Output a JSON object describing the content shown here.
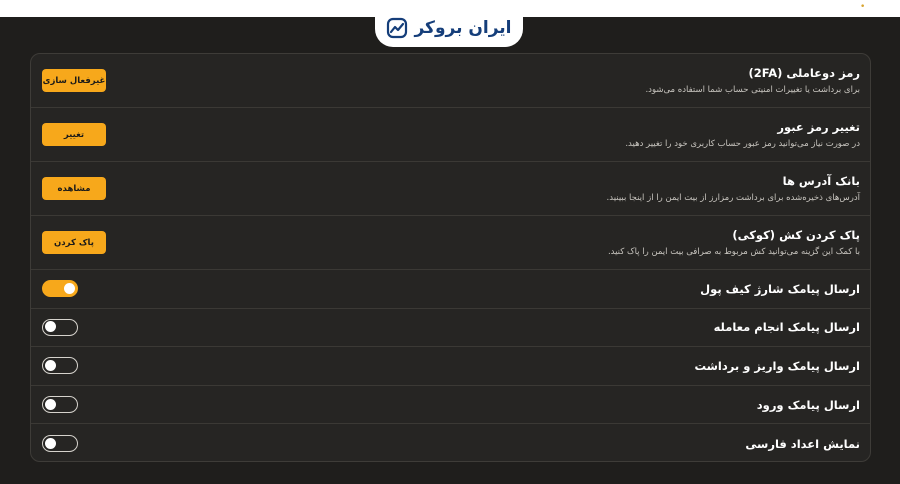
{
  "brand": {
    "name": "ایران بروکر",
    "color": "#153e7a"
  },
  "theme": {
    "accent": "#f7a81b",
    "background": "#1f1e1c",
    "card": "#262523"
  },
  "settings": [
    {
      "title": "رمز دوعاملی (2FA)",
      "description": "برای برداشت یا تغییرات امنیتی حساب شما استفاده می‌شود.",
      "button": "غیرفعال سازی"
    },
    {
      "title": "تغییر رمز عبور",
      "description": "در صورت نیاز می‌توانید رمز عبور حساب کاربری خود را تغییر دهید.",
      "button": "تغییر"
    },
    {
      "title": "بانک آدرس ها",
      "description": "آدرس‌های ذخیره‌شده برای برداشت رمزارز از بیت ایمن را از اینجا ببینید.",
      "button": "مشاهده"
    },
    {
      "title": "پاک کردن کش (کوکی)",
      "description": "با کمک این گزینه می‌توانید کش مربوط به صرافی بیت ایمن را پاک کنید.",
      "button": "پاک کردن"
    }
  ],
  "toggles": [
    {
      "label": "ارسال پیامک شارژ کیف پول",
      "on": true
    },
    {
      "label": "ارسال پیامک انجام معامله",
      "on": false
    },
    {
      "label": "ارسال پیامک واریز و برداشت",
      "on": false
    },
    {
      "label": "ارسال پیامک ورود",
      "on": false
    },
    {
      "label": "نمایش اعداد فارسی",
      "on": false
    }
  ]
}
